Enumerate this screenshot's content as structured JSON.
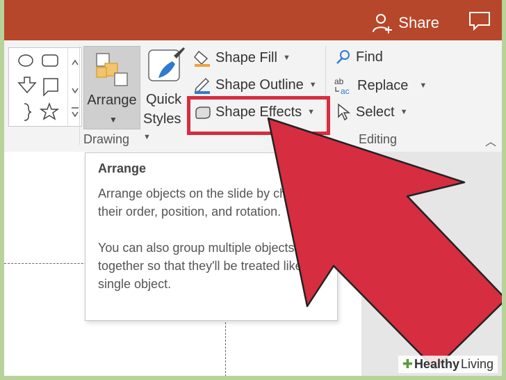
{
  "titlebar": {
    "share_label": "Share"
  },
  "ribbon": {
    "arrange_label": "Arrange",
    "quick_styles_line1": "Quick",
    "quick_styles_line2": "Styles",
    "shape_fill": "Shape Fill",
    "shape_outline": "Shape Outline",
    "shape_effects": "Shape Effects",
    "find": "Find",
    "replace": "Replace",
    "select": "Select",
    "group_drawing": "Drawing",
    "group_editing": "Editing"
  },
  "tooltip": {
    "title": "Arrange",
    "para1": "Arrange objects on the slide by changing their order, position, and rotation.",
    "para2": "You can also group multiple objects together so that they'll be treated like a single object."
  },
  "watermark": {
    "part1": "Healthy",
    "part2": "Living"
  },
  "colors": {
    "titlebar": "#b7472a",
    "highlight": "#d62d40",
    "arrow": "#d62d40",
    "frame": "#b7d39a"
  }
}
